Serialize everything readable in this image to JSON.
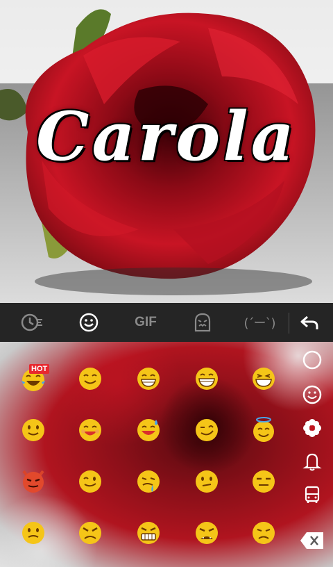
{
  "wallpaper": {
    "name_text": "Carola"
  },
  "toolbar": {
    "gif_label": "GIF",
    "kaomoji_label": "(´ー`)",
    "active_tab": "emoji",
    "icons": [
      "recent-clock-icon",
      "smiley-icon",
      "gif",
      "sticker-icon",
      "kaomoji",
      "back-arrow-icon"
    ]
  },
  "emoji_panel": {
    "hot_badge": "HOT",
    "rows": [
      [
        "tears-of-joy",
        "smile",
        "grin",
        "big-grin",
        "grin-squint"
      ],
      [
        "slight-smile",
        "smile-closed-eyes",
        "grinning-sweat",
        "wink-smile",
        "halo"
      ],
      [
        "imp",
        "wink",
        "drooling",
        "neutral-smirk",
        "expressionless"
      ],
      [
        "confused",
        "angry",
        "grimace",
        "fangs-frown",
        "sad"
      ]
    ],
    "side_icons": [
      "smiley-category-icon",
      "flower-icon",
      "bell-icon",
      "bus-icon",
      "delete-key-icon"
    ]
  },
  "colors": {
    "toolbar_bg": "#252525",
    "icon_inactive": "#8a8a8a",
    "icon_active": "#ffffff",
    "emoji_yellow": "#f5c518",
    "rose_red": "#b0141f",
    "hot_red": "#e8282e"
  }
}
